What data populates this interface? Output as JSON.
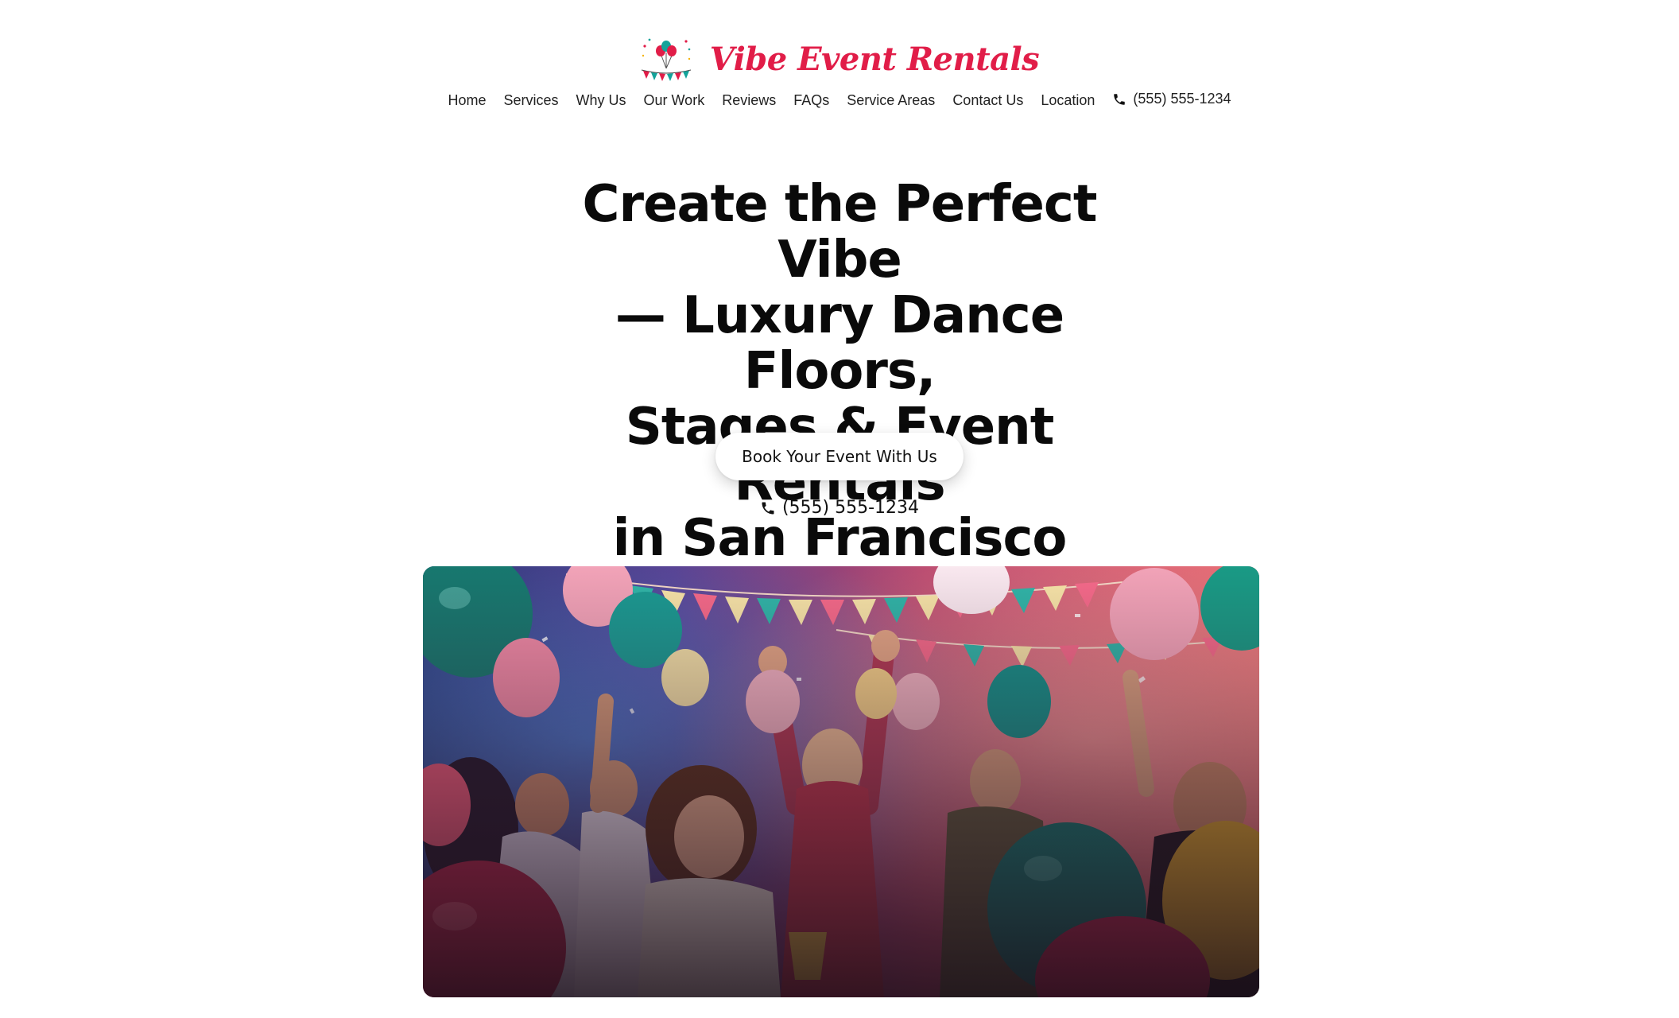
{
  "brand": {
    "name": "Vibe Event Rentals",
    "color": "#e11d48"
  },
  "nav": {
    "items": [
      {
        "label": "Home"
      },
      {
        "label": "Services"
      },
      {
        "label": "Why Us"
      },
      {
        "label": "Our Work"
      },
      {
        "label": "Reviews"
      },
      {
        "label": "FAQs"
      },
      {
        "label": "Service Areas"
      },
      {
        "label": "Contact Us"
      },
      {
        "label": "Location"
      }
    ],
    "phone": "(555) 555-1234",
    "phone_icon": "phone-icon"
  },
  "hero": {
    "title_lines": [
      "Create the Perfect Vibe",
      "— Luxury Dance Floors,",
      "Stages & Event Rentals",
      "in San Francisco"
    ],
    "cta_label": "Book Your Event With Us",
    "phone": "(555) 555-1234",
    "image_subject": "party-crowd-with-balloons-photo"
  },
  "colors": {
    "accent": "#e11d48",
    "teal": "#14a39a",
    "pink": "#f27a9c",
    "text": "#111111"
  }
}
